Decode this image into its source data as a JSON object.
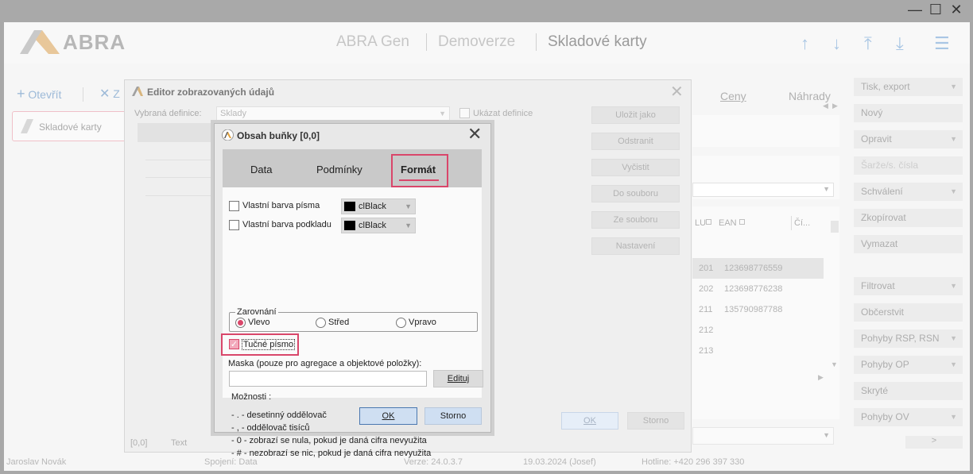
{
  "window_controls": {
    "minimize": "—",
    "maximize": "☐",
    "close": "✕"
  },
  "app": {
    "brand": "ABRA",
    "breadcrumbs": [
      "ABRA Gen",
      "Demoverze",
      "Skladové karty"
    ],
    "nav_icons": [
      "arrow-up-icon",
      "arrow-down-icon",
      "arrow-top-icon",
      "arrow-bottom-icon",
      "menu-icon"
    ]
  },
  "toolbar": {
    "open_label": "Otevřít",
    "close_label": "Z"
  },
  "left_panel": {
    "card_label": "Skladové karty"
  },
  "right_tabs": {
    "prices": "Ceny",
    "substitutes": "Náhrady"
  },
  "grid": {
    "headers": [
      "LU",
      "EAN",
      "Čí..."
    ],
    "rows": [
      {
        "lu": "201",
        "ean": "123698776559"
      },
      {
        "lu": "202",
        "ean": "123698776238"
      },
      {
        "lu": "211",
        "ean": "135790987788"
      },
      {
        "lu": "212",
        "ean": ""
      },
      {
        "lu": "213",
        "ean": ""
      }
    ]
  },
  "right_buttons": [
    {
      "label": "Tisk, export",
      "dropdown": true
    },
    {
      "label": "Nový",
      "dropdown": false
    },
    {
      "label": "Opravit",
      "dropdown": true
    },
    {
      "label": "Šarže/s. čísla",
      "dropdown": false
    },
    {
      "label": "Schválení",
      "dropdown": true
    },
    {
      "label": "Zkopírovat",
      "dropdown": false
    },
    {
      "label": "Vymazat",
      "dropdown": false
    },
    {
      "label": "Filtrovat",
      "dropdown": true
    },
    {
      "label": "Občerstvit",
      "dropdown": false
    },
    {
      "label": "Pohyby RSP, RSN",
      "dropdown": true
    },
    {
      "label": "Pohyby OP",
      "dropdown": true
    },
    {
      "label": "Skryté",
      "dropdown": false
    },
    {
      "label": "Pohyby OV",
      "dropdown": true
    }
  ],
  "right_pager": ">",
  "statusbar": {
    "user": "Jaroslav Novák",
    "connection": "Spojení: Data",
    "version": "Verze: 24.0.3.7",
    "date": "19.03.2024 (Josef)",
    "hotline": "Hotline: +420 296 397 330"
  },
  "editor": {
    "title": "Editor zobrazovaných údajů",
    "definition_label": "Vybraná definice:",
    "definition_value": "Sklady",
    "show_definition_label": "Ukázat definice",
    "buttons": [
      "Uložit jako",
      "Odstranit",
      "Vyčistit",
      "Do souboru",
      "Ze souboru",
      "Nastavení"
    ],
    "ok_label": "OK",
    "cancel_label": "Storno",
    "status_cell": "[0,0]",
    "status_type": "Text"
  },
  "modal": {
    "title": "Obsah buňky [0,0]",
    "tabs": [
      "Data",
      "Podmínky",
      "Formát"
    ],
    "active_tab": "Formát",
    "font_color_label": "Vlastní barva písma",
    "font_color_value": "clBlack",
    "bg_color_label": "Vlastní barva podkladu",
    "bg_color_value": "clBlack",
    "alignment_label": "Zarovnání",
    "align_options": [
      "Vlevo",
      "Střed",
      "Vpravo"
    ],
    "align_selected": "Vlevo",
    "bold_label": "Tučné písmo",
    "bold_checked": true,
    "mask_label": "Maska (pouze pro agregace a objektové položky):",
    "mask_value": "",
    "edit_button": "Edituj",
    "options_label": "Možnosti :",
    "options": [
      "- . - desetinný oddělovač",
      "- , - oddělovač tisíců",
      "- 0 - zobrazí se nula, pokud je daná cifra nevyužita",
      "- # - nezobrazí se nic, pokud je daná cifra nevyužita"
    ],
    "ok_label": "OK",
    "cancel_label": "Storno"
  },
  "colors": {
    "accent": "#d9466a",
    "link": "#9dbad8"
  }
}
